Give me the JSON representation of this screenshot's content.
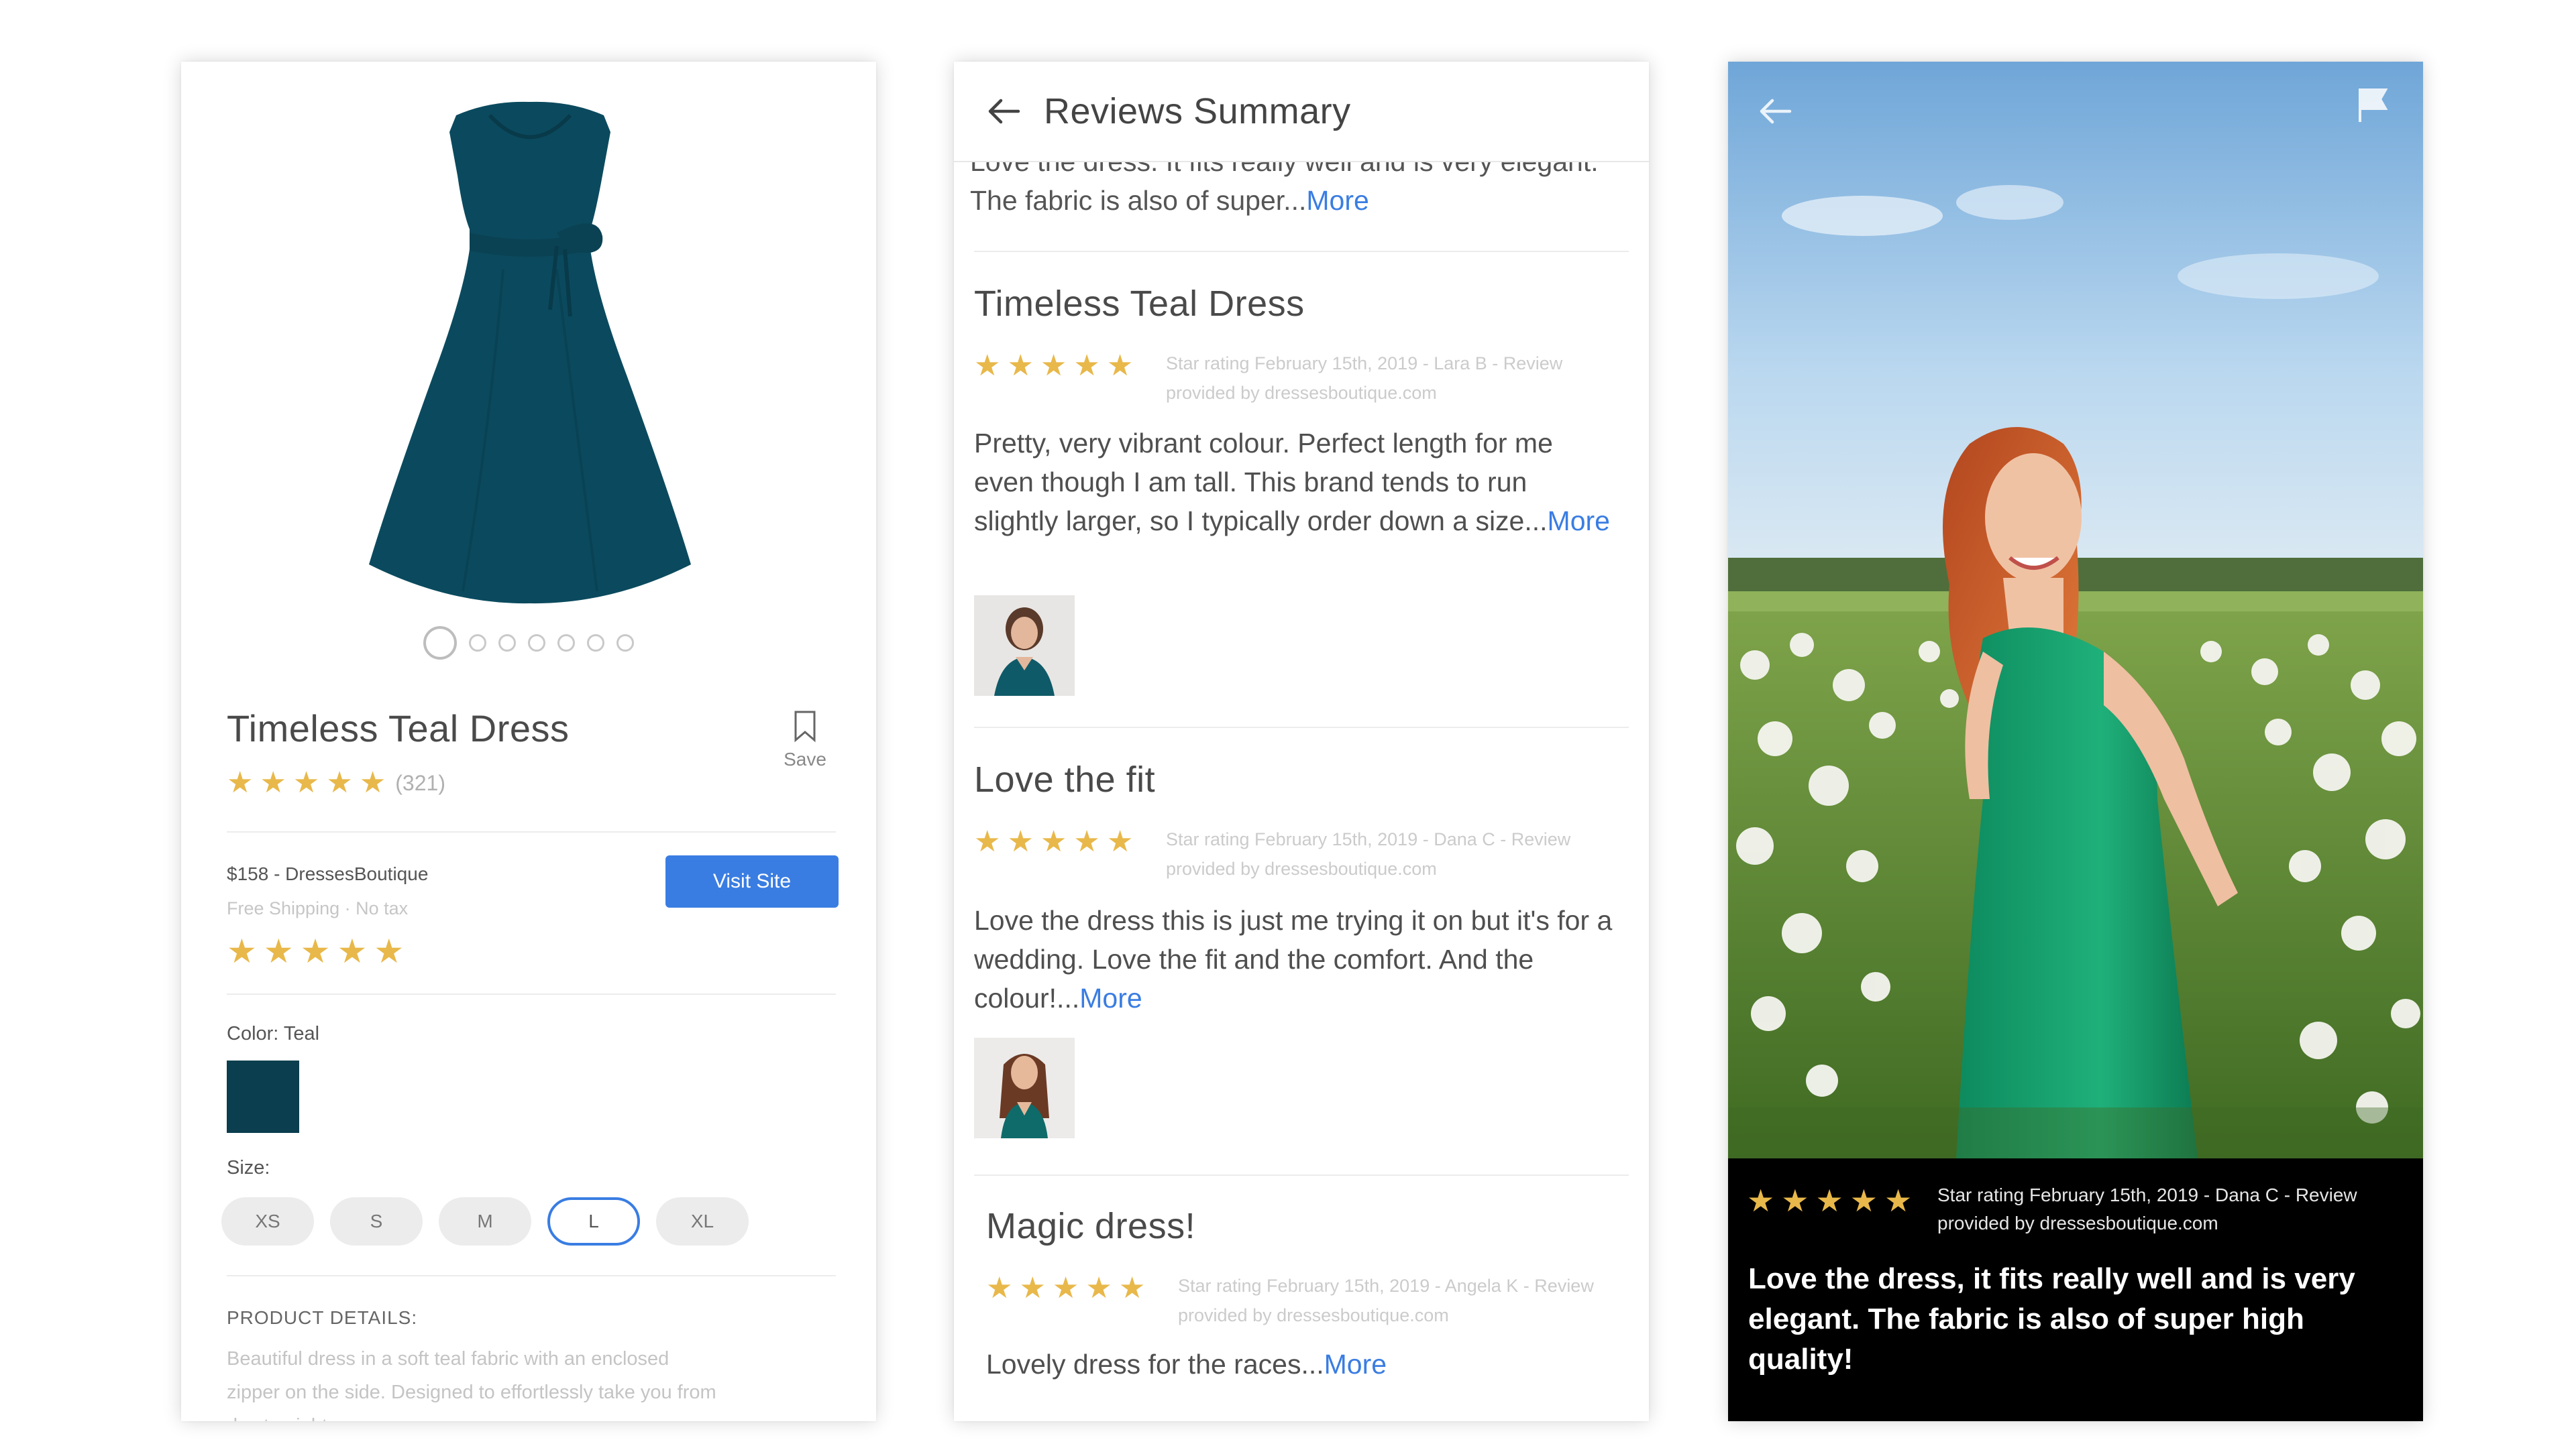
{
  "product": {
    "title": "Timeless Teal Dress",
    "rating_count": "(321)",
    "save_label": "Save",
    "seller": "$158 - DressesBoutique",
    "shipping": "Free Shipping · No tax",
    "visit_label": "Visit Site",
    "color_label": "Color: Teal",
    "color_value": "#0b3e4f",
    "size_label": "Size:",
    "sizes": [
      "XS",
      "S",
      "M",
      "L",
      "XL"
    ],
    "selected_size": "L",
    "details_label": "PRODUCT DETAILS:",
    "details_text": "Beautiful dress in a soft teal fabric with an enclosed zipper on the side. Designed to effortlessly take you from day to night.",
    "image_count": 7
  },
  "reviews": {
    "header_title": "Reviews Summary",
    "cut_text": "Love the dress. It fits really well and is very elegant. The fabric is also of super...",
    "more_label": "More",
    "items": [
      {
        "title": "Timeless Teal Dress",
        "meta": "Star rating February 15th, 2019 - Lara B - Review provided by dressesboutique.com",
        "text": "Pretty, very vibrant colour. Perfect length for me even though I am tall. This brand tends to run slightly larger, so I typically order down a size..."
      },
      {
        "title": "Love the fit",
        "meta": "Star rating February 15th, 2019 - Dana C - Review provided by dressesboutique.com",
        "text": "Love the dress this is just me trying it on but it's for a wedding. Love the fit and the comfort. And the colour!..."
      },
      {
        "title": "Magic dress!",
        "meta": "Star rating February 15th, 2019 - Angela K - Review provided by dressesboutique.com",
        "text": "Lovely dress for the races..."
      }
    ]
  },
  "photo_review": {
    "meta": "Star rating February 15th, 2019 - Dana C - Review provided by dressesboutique.com",
    "text": "Love the dress, it fits really well and is very elegant. The fabric is also of super high quality!"
  },
  "colors": {
    "accent": "#3a7de2",
    "star": "#e8b84a",
    "dress": "#0b4a5e"
  }
}
